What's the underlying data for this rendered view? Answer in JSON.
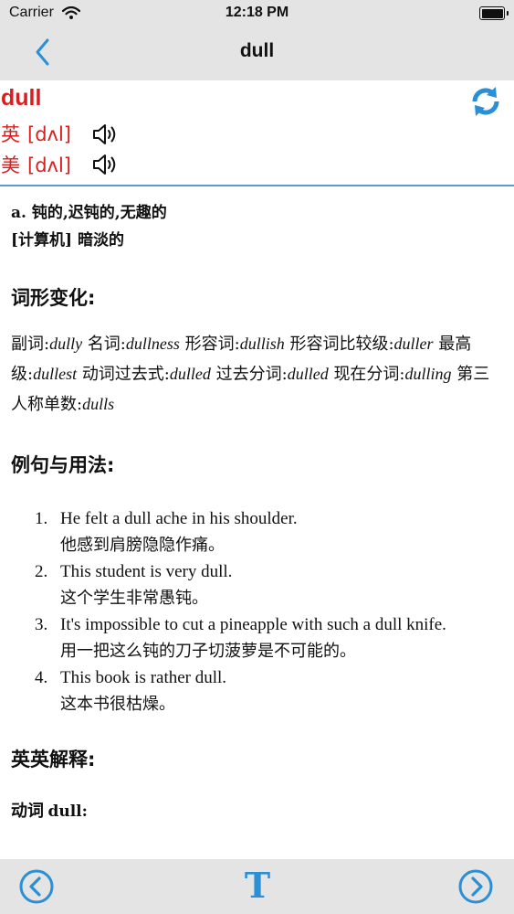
{
  "status_bar": {
    "carrier": "Carrier",
    "time": "12:18 PM"
  },
  "nav": {
    "title": "dull",
    "back_icon": "chevron-left-icon"
  },
  "word": {
    "headword": "dull",
    "uk": {
      "label": "英",
      "ipa": "[dʌl]"
    },
    "us": {
      "label": "美",
      "ipa": "[dʌl]"
    }
  },
  "definitions": [
    "a. 钝的,迟钝的,无趣的",
    "[计算机] 暗淡的"
  ],
  "word_forms": {
    "heading": "词形变化:",
    "items": [
      {
        "label": "副词:",
        "value": "dully"
      },
      {
        "label": "名词:",
        "value": "dullness"
      },
      {
        "label": "形容词:",
        "value": "dullish"
      },
      {
        "label": "形容词比较级:",
        "value": "duller"
      },
      {
        "label": "最高级:",
        "value": "dullest"
      },
      {
        "label": "动词过去式:",
        "value": "dulled"
      },
      {
        "label": "过去分词:",
        "value": "dulled"
      },
      {
        "label": "现在分词:",
        "value": "dulling"
      },
      {
        "label": "第三人称单数:",
        "value": "dulls"
      }
    ]
  },
  "examples": {
    "heading": "例句与用法:",
    "items": [
      {
        "num": "1.",
        "en": "He felt a dull ache in his shoulder.",
        "zh": "他感到肩膀隐隐作痛。"
      },
      {
        "num": "2.",
        "en": "This student is very dull.",
        "zh": "这个学生非常愚钝。"
      },
      {
        "num": "3.",
        "en": "It's impossible to cut a pineapple with such a dull knife.",
        "zh": "用一把这么钝的刀子切菠萝是不可能的。"
      },
      {
        "num": "4.",
        "en": "This book is rather dull.",
        "zh": "这本书很枯燥。"
      }
    ]
  },
  "english_explanation": {
    "heading": "英英解释:",
    "pos_label": "动词",
    "pos_word": "dull:"
  },
  "toolbar": {
    "font_label": "T"
  },
  "colors": {
    "accent": "#2b8fd6",
    "headword": "#d81e1e",
    "bar": "#e4e4e4",
    "divider": "#5b9bd5"
  }
}
